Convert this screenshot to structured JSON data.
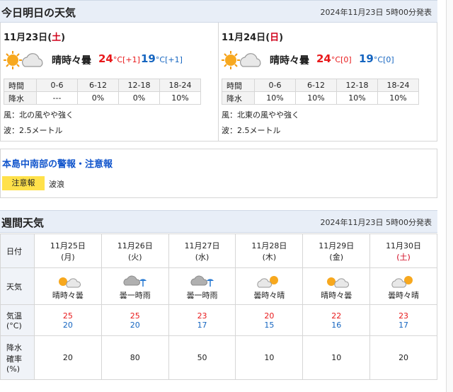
{
  "today_header": {
    "title": "今日明日の天気",
    "issued": "2024年11月23日 5時00分発表"
  },
  "days": [
    {
      "date": "11月23日",
      "dow": "土",
      "dow_type": "sat",
      "icon": "sun-cloud",
      "telop": "晴時々曇",
      "high": "24",
      "high_diff": "[+1]",
      "low": "19",
      "low_diff": "[+1]",
      "unit": "°C",
      "periods": [
        "0-6",
        "6-12",
        "12-18",
        "18-24"
      ],
      "rain": [
        "---",
        "0%",
        "0%",
        "10%"
      ],
      "row_time": "時間",
      "row_rain": "降水",
      "wind": "風：北の風やや強く",
      "wave": "波：2.5メートル"
    },
    {
      "date": "11月24日",
      "dow": "日",
      "dow_type": "sun",
      "icon": "sun-cloud",
      "telop": "晴時々曇",
      "high": "24",
      "high_diff": "[0]",
      "low": "19",
      "low_diff": "[0]",
      "unit": "°C",
      "periods": [
        "0-6",
        "6-12",
        "12-18",
        "18-24"
      ],
      "rain": [
        "10%",
        "10%",
        "10%",
        "10%"
      ],
      "row_time": "時間",
      "row_rain": "降水",
      "wind": "風：北東の風やや強く",
      "wave": "波：2.5メートル"
    }
  ],
  "warning": {
    "title": "本島中南部の警報・注意報",
    "badge": "注意報",
    "items": "波浪"
  },
  "weekly_header": {
    "title": "週間天気",
    "issued": "2024年11月23日 5時00分発表"
  },
  "weekly": {
    "labels": {
      "date": "日付",
      "weather": "天気",
      "temp": "気温\n(°C)",
      "rain": "降水\n確率\n(%)"
    },
    "days": [
      {
        "date": "11月25日",
        "dow": "(月)",
        "icon": "sun-cloud",
        "telop": "晴時々曇",
        "high": "25",
        "low": "20",
        "rain": "20"
      },
      {
        "date": "11月26日",
        "dow": "(火)",
        "icon": "cloud-rain",
        "telop": "曇一時雨",
        "high": "25",
        "low": "20",
        "rain": "80"
      },
      {
        "date": "11月27日",
        "dow": "(水)",
        "icon": "cloud-rain",
        "telop": "曇一時雨",
        "high": "23",
        "low": "17",
        "rain": "50"
      },
      {
        "date": "11月28日",
        "dow": "(木)",
        "icon": "cloud-sun",
        "telop": "曇時々晴",
        "high": "20",
        "low": "15",
        "rain": "10"
      },
      {
        "date": "11月29日",
        "dow": "(金)",
        "icon": "sun-cloud",
        "telop": "晴時々曇",
        "high": "22",
        "low": "16",
        "rain": "10"
      },
      {
        "date": "11月30日",
        "dow": "(土)",
        "icon": "cloud-sun",
        "telop": "曇時々晴",
        "high": "23",
        "low": "17",
        "rain": "20",
        "sat": true
      }
    ]
  }
}
